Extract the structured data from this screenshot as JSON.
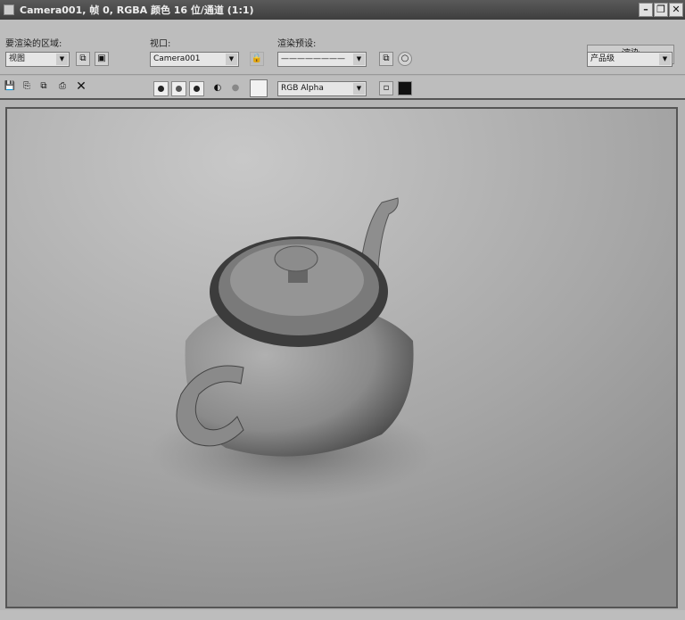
{
  "window": {
    "title": "Camera001, 帧 0, RGBA 颜色 16 位/通道 (1:1)",
    "minimize": "–",
    "restore": "❐",
    "close": "✕"
  },
  "toolbar": {
    "area_label": "要渲染的区域:",
    "area_value": "视图",
    "viewport_label": "视口:",
    "viewport_value": "Camera001",
    "preset_label": "渲染预设:",
    "preset_value": "————————",
    "render_button": "渲染",
    "render_mode": "产品级",
    "channel_value": "RGB Alpha"
  },
  "colors": {
    "title_bg": "#4a4a4a",
    "toolbar_bg": "#bdbdbd"
  }
}
